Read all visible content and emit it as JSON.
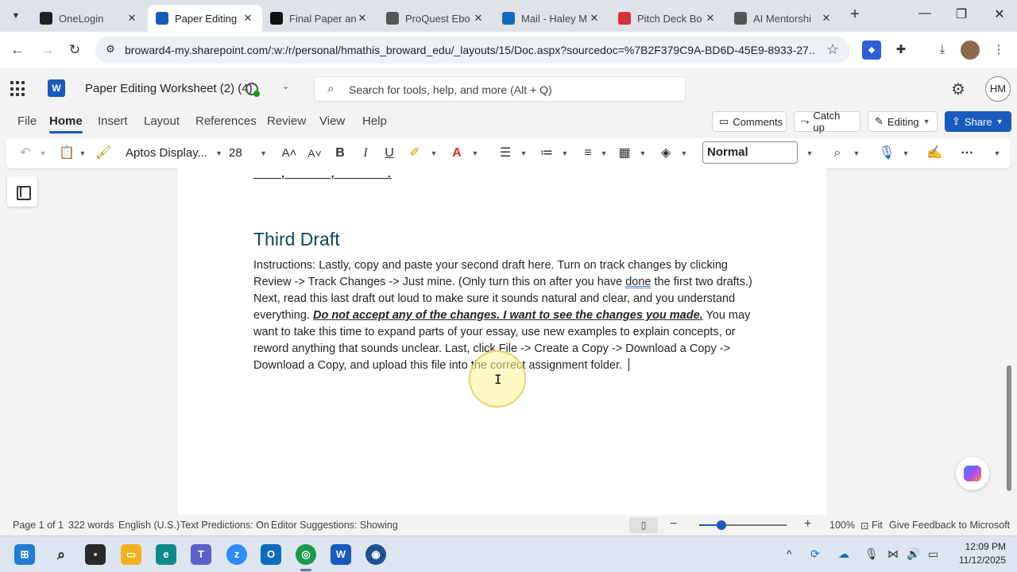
{
  "browser": {
    "tabs": [
      {
        "title": "OneLogin",
        "icon": "onelogin-icon",
        "color": "#1f1f1f"
      },
      {
        "title": "Paper Editing",
        "icon": "word-icon",
        "color": "#185abd",
        "active": true
      },
      {
        "title": "Final Paper an",
        "icon": "d2l-icon",
        "color": "#111111"
      },
      {
        "title": "ProQuest Ebo",
        "icon": "globe-icon",
        "color": "#555555"
      },
      {
        "title": "Mail - Haley M",
        "icon": "outlook-icon",
        "color": "#0f6cbd"
      },
      {
        "title": "Pitch Deck Bo",
        "icon": "pitch-icon",
        "color": "#d13438"
      },
      {
        "title": "AI Mentorshi",
        "icon": "globe-icon",
        "color": "#555555"
      }
    ],
    "url": "broward4-my.sharepoint.com/:w:/r/personal/hmathis_broward_edu/_layouts/15/Doc.aspx?sourcedoc=%7B2F379C9A-BD6D-45E9-8933-27..."
  },
  "word": {
    "doc_title": "Paper Editing Worksheet (2) (4)",
    "search_placeholder": "Search for tools, help, and more (Alt + Q)",
    "avatar_initials": "HM",
    "ribbon_tabs": [
      "File",
      "Home",
      "Insert",
      "Layout",
      "References",
      "Review",
      "View",
      "Help"
    ],
    "active_tab": "Home",
    "buttons": {
      "comments": "Comments",
      "catch_up": "Catch up",
      "editing": "Editing",
      "share": "Share"
    },
    "toolbar": {
      "font": "Aptos Display...",
      "size": "28",
      "style": "Normal"
    }
  },
  "document": {
    "previous_line": "____, ______, _______.",
    "heading": "Third Draft",
    "para_part1": "Instructions: Lastly, copy and paste your second draft here.  Turn on track changes by clicking Review -> Track Changes -> Just mine.  (Only turn this on after you have ",
    "para_done": "done",
    "para_part2": " the first two drafts.)  Next, read this last draft out loud to make sure it sounds natural and clear, and you understand everything.  ",
    "para_emph": "Do not accept any of the changes.  I want to see the changes you made.",
    "para_part3": " You may want to take this time to expand parts of your essay, use new examples to explain concepts, or reword anything that sounds unclear.  Last, click File -> Create a Copy -> Download a Copy -> Download a Copy, and upload this file into the correct assignment folder. "
  },
  "status": {
    "page": "Page 1 of 1",
    "words": "322 words",
    "language": "English (U.S.)",
    "predictions": "Text Predictions: On",
    "suggestions": "Editor Suggestions: Showing",
    "zoom": "100%",
    "fit": "Fit",
    "feedback": "Give Feedback to Microsoft",
    "zoom_level": 0.25
  },
  "taskbar": {
    "time": "12:09 PM",
    "date": "11/12/2025"
  },
  "colors": {
    "accent": "#185abd",
    "heading": "#0f4761"
  }
}
